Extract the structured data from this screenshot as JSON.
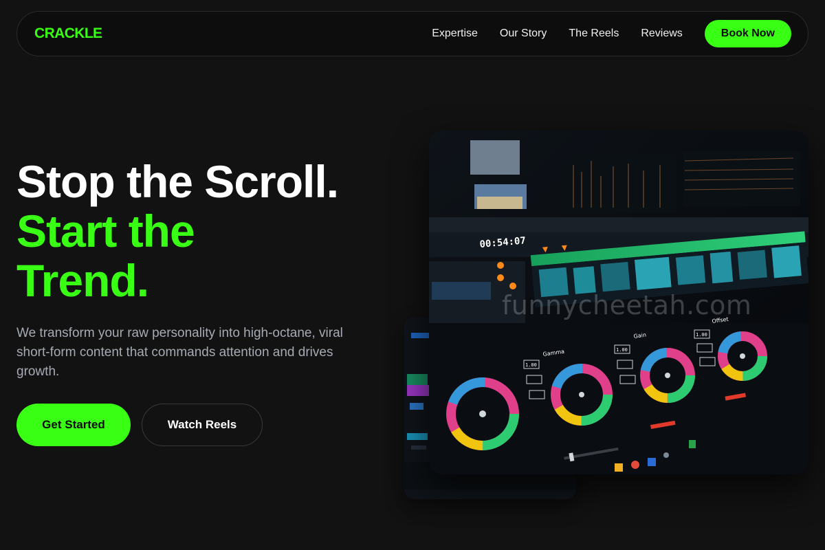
{
  "brand": {
    "name": "CRACKLE",
    "accent": "#39ff14"
  },
  "nav": {
    "links": [
      "Expertise",
      "Our Story",
      "The Reels",
      "Reviews"
    ],
    "cta": "Book Now"
  },
  "hero": {
    "title_line1": "Stop the Scroll.",
    "title_line2": "Start the",
    "title_line3": "Trend.",
    "subtitle": "We transform your raw personality into high-octane, viral short-form content that commands attention and drives growth.",
    "primary_cta": "Get Started",
    "secondary_cta": "Watch Reels"
  },
  "media": {
    "timecode": "00:54:07",
    "watermark": "funnycheetah.com",
    "wheel_labels": [
      "Gamma",
      "Gain",
      "Offset"
    ],
    "readouts": [
      "1.00",
      "1.00",
      "1.00"
    ]
  }
}
